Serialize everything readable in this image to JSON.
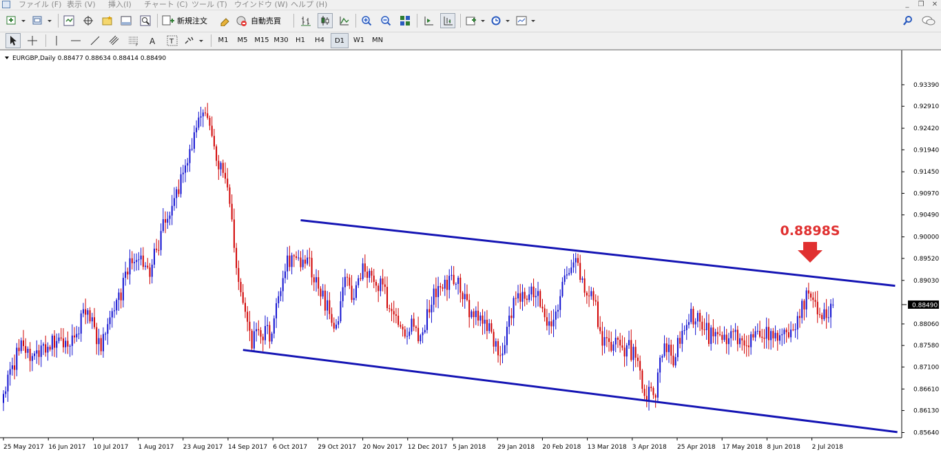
{
  "menu": {
    "items": [
      "ファイル (F)",
      "表示 (V)",
      "挿入(I)",
      "チャート (C)",
      "ツール (T)",
      "ウインドウ (W)",
      "ヘルプ (H)"
    ]
  },
  "toolbar": {
    "new_order_label": "新規注文",
    "auto_trading_label": "自動売買",
    "timeframes": [
      "M1",
      "M5",
      "M15",
      "M30",
      "H1",
      "H4",
      "D1",
      "W1",
      "MN"
    ],
    "active_timeframe": "D1"
  },
  "chart_header": {
    "title": "EURGBP,Daily  0.88477 0.88634 0.88414 0.88490"
  },
  "annotation": {
    "text": "0.8898S",
    "color": "#e03030"
  },
  "colors": {
    "bull": "#1010d0",
    "bear": "#d00000",
    "channel": "#1414b4",
    "price_label_bg": "#000000"
  },
  "chart_data": {
    "type": "candlestick",
    "symbol": "EURGBP",
    "timeframe": "Daily",
    "ohlc_current": {
      "open": 0.88477,
      "high": 0.88634,
      "low": 0.88414,
      "close": 0.8849
    },
    "current_price_label": "0.88490",
    "y_ticks": [
      "0.93390",
      "0.92910",
      "0.92420",
      "0.91940",
      "0.91450",
      "0.90970",
      "0.90490",
      "0.90000",
      "0.89520",
      "0.89030",
      "0.88060",
      "0.87580",
      "0.87100",
      "0.86610",
      "0.86130",
      "0.85640"
    ],
    "ylim": [
      0.8554,
      0.9365
    ],
    "x_labels": [
      "25 May 2017",
      "16 Jun 2017",
      "10 Jul 2017",
      "1 Aug 2017",
      "23 Aug 2017",
      "14 Sep 2017",
      "6 Oct 2017",
      "29 Oct 2017",
      "20 Nov 2017",
      "12 Dec 2017",
      "5 Jan 2018",
      "29 Jan 2018",
      "20 Feb 2018",
      "13 Mar 2018",
      "3 Apr 2018",
      "25 Apr 2018",
      "17 May 2018",
      "8 Jun 2018",
      "2 Jul 2018"
    ],
    "anchors": [
      [
        0,
        0.865
      ],
      [
        8,
        0.876
      ],
      [
        14,
        0.872
      ],
      [
        22,
        0.877
      ],
      [
        30,
        0.877
      ],
      [
        38,
        0.884
      ],
      [
        44,
        0.875
      ],
      [
        52,
        0.886
      ],
      [
        58,
        0.8955
      ],
      [
        66,
        0.893
      ],
      [
        74,
        0.905
      ],
      [
        80,
        0.912
      ],
      [
        88,
        0.925
      ],
      [
        92,
        0.9275
      ],
      [
        96,
        0.918
      ],
      [
        100,
        0.914
      ],
      [
        104,
        0.898
      ],
      [
        108,
        0.885
      ],
      [
        112,
        0.8765
      ],
      [
        116,
        0.879
      ],
      [
        120,
        0.878
      ],
      [
        124,
        0.887
      ],
      [
        128,
        0.8945
      ],
      [
        132,
        0.894
      ],
      [
        136,
        0.896
      ],
      [
        140,
        0.891
      ],
      [
        146,
        0.884
      ],
      [
        150,
        0.879
      ],
      [
        154,
        0.893
      ],
      [
        158,
        0.886
      ],
      [
        162,
        0.892
      ],
      [
        166,
        0.89
      ],
      [
        170,
        0.89
      ],
      [
        176,
        0.882
      ],
      [
        180,
        0.879
      ],
      [
        184,
        0.88
      ],
      [
        188,
        0.878
      ],
      [
        194,
        0.887
      ],
      [
        198,
        0.888
      ],
      [
        204,
        0.891
      ],
      [
        210,
        0.884
      ],
      [
        214,
        0.882
      ],
      [
        218,
        0.881
      ],
      [
        222,
        0.875
      ],
      [
        226,
        0.876
      ],
      [
        230,
        0.885
      ],
      [
        234,
        0.888
      ],
      [
        238,
        0.887
      ],
      [
        242,
        0.886
      ],
      [
        246,
        0.88
      ],
      [
        250,
        0.885
      ],
      [
        254,
        0.891
      ],
      [
        258,
        0.894
      ],
      [
        262,
        0.889
      ],
      [
        266,
        0.886
      ],
      [
        270,
        0.877
      ],
      [
        274,
        0.876
      ],
      [
        278,
        0.875
      ],
      [
        282,
        0.875
      ],
      [
        286,
        0.872
      ],
      [
        290,
        0.864
      ],
      [
        294,
        0.866
      ],
      [
        298,
        0.876
      ],
      [
        302,
        0.873
      ],
      [
        306,
        0.88
      ],
      [
        310,
        0.883
      ],
      [
        314,
        0.881
      ],
      [
        318,
        0.878
      ],
      [
        322,
        0.877
      ],
      [
        326,
        0.876
      ],
      [
        330,
        0.878
      ],
      [
        334,
        0.876
      ],
      [
        338,
        0.879
      ],
      [
        342,
        0.878
      ],
      [
        346,
        0.879
      ],
      [
        350,
        0.876
      ],
      [
        354,
        0.879
      ],
      [
        358,
        0.882
      ],
      [
        362,
        0.886
      ],
      [
        366,
        0.885
      ],
      [
        370,
        0.883
      ],
      [
        374,
        0.8849
      ]
    ],
    "channel": {
      "upper": {
        "from": [
          0.9037,
          134
        ],
        "to": [
          0.8891,
          402
        ]
      },
      "lower": {
        "from": [
          0.8748,
          108
        ],
        "to": [
          0.8565,
          403
        ]
      }
    }
  }
}
